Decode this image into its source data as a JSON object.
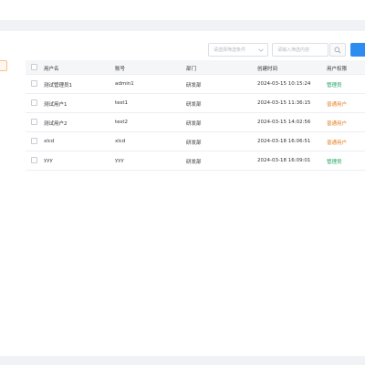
{
  "toolbar": {
    "filter_placeholder": "请选择筛选条件",
    "search_placeholder": "请输入筛选内容"
  },
  "table": {
    "columns": [
      "用户名",
      "账号",
      "部门",
      "创建时间",
      "用户权限"
    ],
    "rows": [
      {
        "username": "测试管理员1",
        "account": "admin1",
        "department": "研发部",
        "created": "2024-03-15 10:15:24",
        "role": "管理员",
        "role_type": "admin"
      },
      {
        "username": "测试用户1",
        "account": "test1",
        "department": "研发部",
        "created": "2024-03-15 11:36:15",
        "role": "普通用户",
        "role_type": "normal"
      },
      {
        "username": "测试用户2",
        "account": "test2",
        "department": "研发部",
        "created": "2024-03-15 14:02:56",
        "role": "普通用户",
        "role_type": "normal"
      },
      {
        "username": "xlcd",
        "account": "xlcd",
        "department": "研发部",
        "created": "2024-03-18 16:06:51",
        "role": "普通用户",
        "role_type": "normal"
      },
      {
        "username": "yyy",
        "account": "yyy",
        "department": "研发部",
        "created": "2024-03-18 16:09:01",
        "role": "管理员",
        "role_type": "admin"
      }
    ]
  },
  "colors": {
    "admin_role": "#19a15f",
    "normal_role": "#e67e22",
    "primary": "#2d8cf0"
  },
  "icons": {
    "search": "search-icon",
    "dropdown": "chevron-down-icon"
  }
}
